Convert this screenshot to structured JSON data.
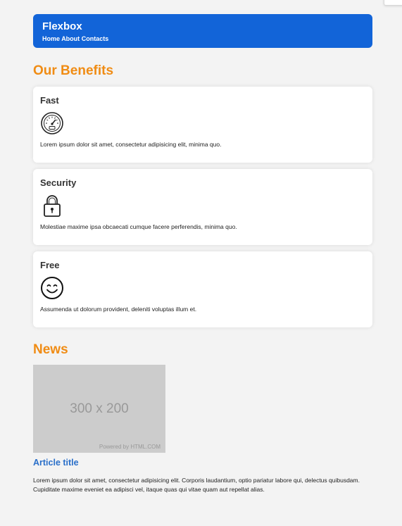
{
  "header": {
    "brand": "Flexbox",
    "nav": [
      "Home",
      "About",
      "Contacts"
    ]
  },
  "benefits": {
    "title": "Our Benefits",
    "items": [
      {
        "title": "Fast",
        "icon": "speedometer-icon",
        "text": "Lorem ipsum dolor sit amet, consectetur adipisicing elit, minima quo."
      },
      {
        "title": "Security",
        "icon": "lock-icon",
        "text": "Molestiae maxime ipsa obcaecati cumque facere perferendis, minima quo."
      },
      {
        "title": "Free",
        "icon": "smiley-icon",
        "text": "Assumenda ut dolorum provident, deleniti voluptas illum et."
      }
    ]
  },
  "news": {
    "title": "News",
    "image": {
      "size_label": "300 x 200",
      "powered_by": "Powered by HTML.COM"
    },
    "article_title": "Article title",
    "article_text": "Lorem ipsum dolor sit amet, consectetur adipisicing elit. Corporis laudantium, optio pariatur labore qui, delectus quibusdam. Cupiditate maxime eveniet ea adipisci vel, itaque quas qui vitae quam aut repellat alias."
  },
  "colors": {
    "header_bg": "#1264d8",
    "accent_orange": "#f08c14",
    "link_blue": "#2a6fc9",
    "page_bg": "#f3f3f3"
  }
}
